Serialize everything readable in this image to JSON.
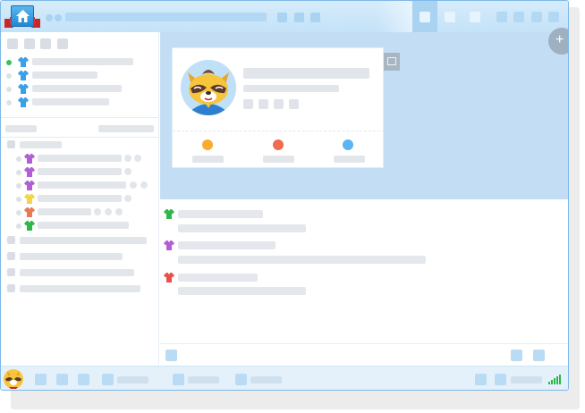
{
  "window": {
    "title_icon": "home-icon",
    "ribbon_icon": "red-ribbon-icon",
    "active_tab_index": 0
  },
  "sidebar": {
    "friends_online": [
      {
        "icon": "shirt-icon",
        "color": "#3aa0e8",
        "status": "online"
      },
      {
        "icon": "shirt-icon",
        "color": "#3aa0e8",
        "status": "offline"
      },
      {
        "icon": "shirt-icon",
        "color": "#3aa0e8",
        "status": "offline"
      },
      {
        "icon": "shirt-icon",
        "color": "#3aa0e8",
        "status": "offline"
      }
    ],
    "group_items": [
      {
        "icon": "shirt-icon",
        "color": "#b25fd6"
      },
      {
        "icon": "shirt-icon",
        "color": "#b25fd6"
      },
      {
        "icon": "shirt-icon",
        "color": "#b25fd6"
      },
      {
        "icon": "shirt-icon",
        "color": "#f2d54a"
      },
      {
        "icon": "shirt-icon",
        "color": "#e87a55"
      },
      {
        "icon": "shirt-icon",
        "color": "#2fb84a"
      }
    ]
  },
  "profile": {
    "avatar_icon": "raccoon-avatar-icon",
    "stat_colors": [
      "#f7ad2f",
      "#f26b4e",
      "#5bb5f0"
    ],
    "add_icon": "+"
  },
  "messages": [
    {
      "icon": "shirt-icon",
      "color": "#2fb84a"
    },
    {
      "icon": "shirt-icon",
      "color": "#b25fd6"
    },
    {
      "icon": "shirt-icon",
      "color": "#e8504a"
    }
  ],
  "statusbar": {
    "avatar_icon": "raccoon-avatar-icon",
    "signal_icon": "signal-icon",
    "signal_color": "#2fb84a"
  }
}
